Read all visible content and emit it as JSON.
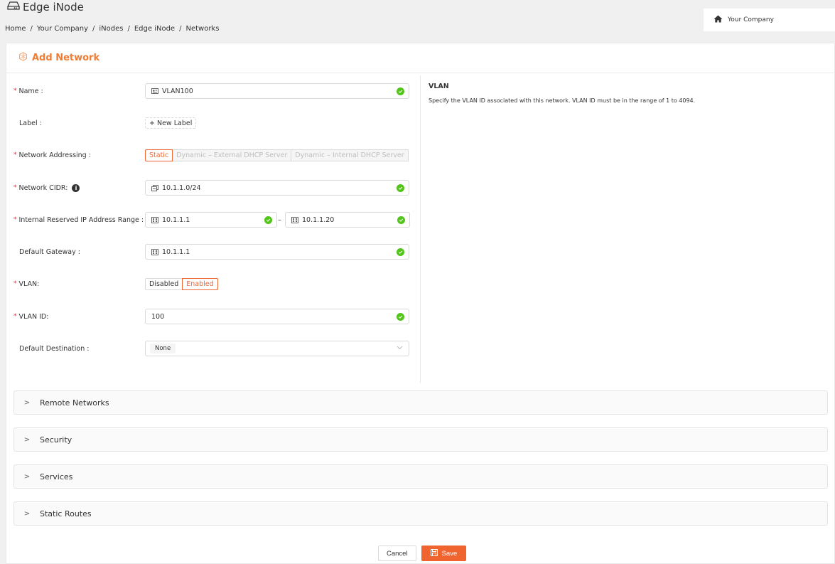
{
  "header": {
    "title": "Edge iNode",
    "title_icon": "hard-drive-icon",
    "breadcrumb": [
      "Home",
      "Your Company",
      "iNodes",
      "Edge iNode",
      "Networks"
    ],
    "breadcrumb_separator": "/",
    "company": "Your Company",
    "company_icon": "home-icon"
  },
  "card": {
    "title": "Add Network",
    "title_icon": "network-icon",
    "accent_color": "#f07d35"
  },
  "form": {
    "name": {
      "label": "Name",
      "required": true,
      "value": "VLAN100",
      "valid": true
    },
    "label": {
      "label": "Label",
      "required": false,
      "button": "+ New Label"
    },
    "addressing": {
      "label": "Network Addressing",
      "required": true,
      "options": [
        "Static",
        "Dynamic – External DHCP Server",
        "Dynamic – Internal DHCP Server"
      ],
      "selected": "Static"
    },
    "cidr": {
      "label": "Network CIDR:",
      "required": true,
      "value": "10.1.1.0/24",
      "valid": true,
      "info_icon": "i"
    },
    "reserved_range": {
      "label": "Internal Reserved IP Address Range",
      "required": true,
      "from": "10.1.1.1",
      "to": "10.1.1.20",
      "separator": "–",
      "valid": true
    },
    "gateway": {
      "label": "Default Gateway",
      "required": false,
      "value": "10.1.1.1",
      "valid": true
    },
    "vlan": {
      "label": "VLAN:",
      "required": true,
      "options": [
        "Disabled",
        "Enabled"
      ],
      "selected": "Enabled"
    },
    "vlan_id": {
      "label": "VLAN ID:",
      "required": true,
      "value": "100",
      "valid": true
    },
    "destination": {
      "label": "Default Destination",
      "required": false,
      "value": "None"
    }
  },
  "help": {
    "title": "VLAN",
    "text": "Specify the VLAN ID associated with this network. VLAN ID must be in the range of 1 to 4094."
  },
  "panels": [
    "Remote Networks",
    "Security",
    "Services",
    "Static Routes"
  ],
  "panel_arrow": ">",
  "footer": {
    "cancel": "Cancel",
    "save": "Save"
  },
  "colors": {
    "primary": "#f0642f",
    "success": "#52c41a",
    "required": "#f5222d"
  }
}
